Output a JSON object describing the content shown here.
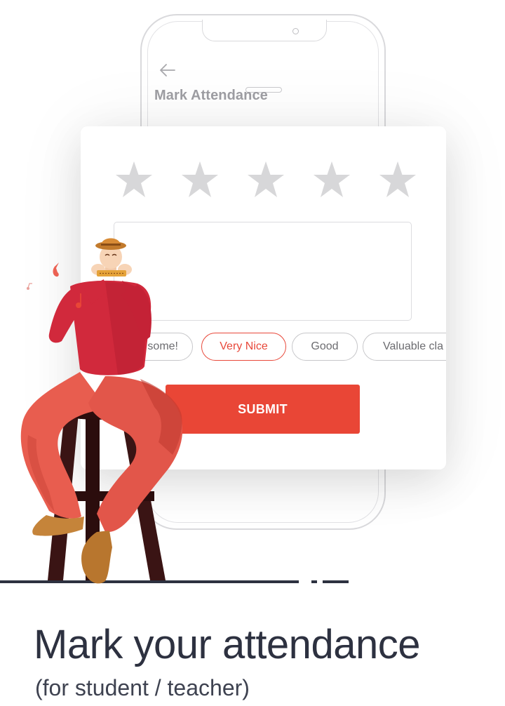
{
  "screen": {
    "title": "Mark Attendance",
    "back_icon": "arrow-left-icon"
  },
  "rating": {
    "max_stars": 5,
    "selected": 0,
    "star_icon": "star-icon",
    "star_color": "#d7d7d9"
  },
  "feedback": {
    "value": "",
    "placeholder": ""
  },
  "chips": [
    {
      "label": "Awesome!",
      "visible_text": "some!",
      "selected": false
    },
    {
      "label": "Very Nice",
      "visible_text": "Very Nice",
      "selected": true
    },
    {
      "label": "Good",
      "visible_text": "Good",
      "selected": false
    },
    {
      "label": "Valuable cla",
      "visible_text": "Valuable cla",
      "selected": false
    }
  ],
  "submit_label": "SUBMIT",
  "headline": "Mark your attendance",
  "subline": "(for student / teacher)",
  "colors": {
    "accent": "#e94636",
    "text_dark": "#2d3140",
    "muted": "#9e9ea3"
  }
}
